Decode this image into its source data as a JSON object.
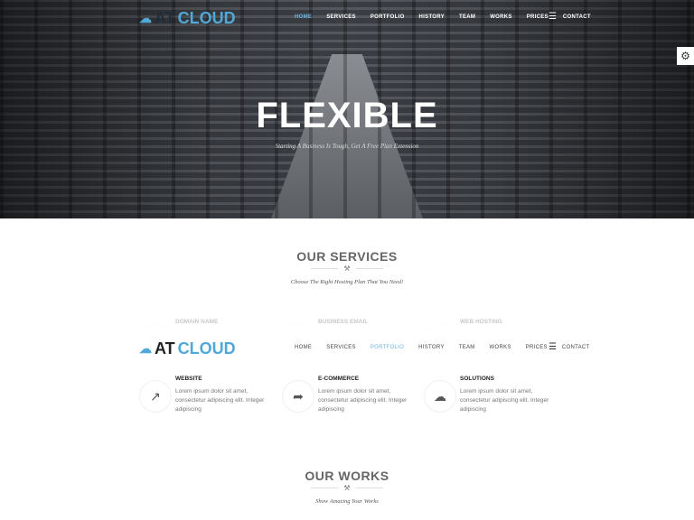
{
  "brand": {
    "at": "AT",
    "cloud": "CLOUD",
    "accent": "#4fa8d8"
  },
  "nav": {
    "items": [
      "HOME",
      "SERVICES",
      "PORTFOLIO",
      "HISTORY",
      "TEAM",
      "WORKS",
      "PRICES",
      "CONTACT"
    ],
    "top_active": 0,
    "sticky_active": 2,
    "menu_icon": "hamburger-icon"
  },
  "settings_icon": "gear-icon",
  "hero": {
    "title": "FLEXIBLE",
    "subtitle": "Starting A Business Is Tough, Get A Free Plan Extension"
  },
  "services": {
    "title": "OUR SERVICES",
    "subtitle": "Choose The Right Hosting Plan That You Need!",
    "items": [
      {
        "title": "DOMAIN NAME",
        "text": "",
        "icon": "globe-icon"
      },
      {
        "title": "BUSINESS EMAIL",
        "text": "",
        "icon": "paper-plane-icon"
      },
      {
        "title": "WEB HOSTING",
        "text": "",
        "icon": "server-icon"
      },
      {
        "title": "WEBSITE",
        "text": "Lorem ipsum dolor sit amet, consectetur adipiscing elit. Integer adipiscing",
        "icon": "external-link-icon"
      },
      {
        "title": "E-COMMERCE",
        "text": "Lorem ipsum dolor sit amet, consectetur adipiscing elit. Integer adipiscing",
        "icon": "share-icon"
      },
      {
        "title": "SOLUTIONS",
        "text": "Lorem ipsum dolor sit amet, consectetur adipiscing elit. Integer adipiscing",
        "icon": "cloud-upload-icon"
      }
    ]
  },
  "works": {
    "title": "OUR WORKS",
    "subtitle": "Show Amazing Your Works"
  }
}
